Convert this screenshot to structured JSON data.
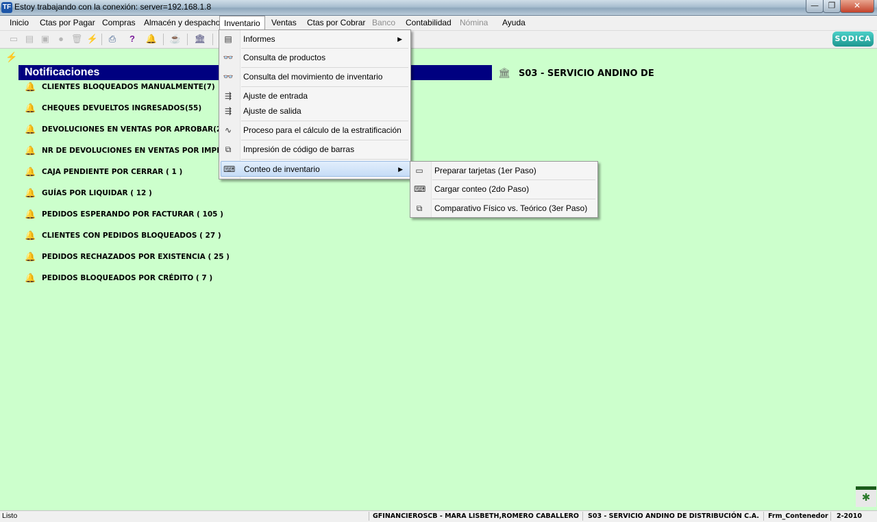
{
  "window": {
    "title": "Estoy trabajando con la conexión: server=192.168.1.8",
    "app_icon": "TF",
    "buttons": {
      "minimize": "—",
      "maximize": "❐",
      "close": "✕"
    }
  },
  "menubar": {
    "items": [
      {
        "label": "Inicio",
        "state": "normal"
      },
      {
        "label": "Ctas por Pagar",
        "state": "normal"
      },
      {
        "label": "Compras",
        "state": "normal"
      },
      {
        "label": "Almacén y despacho",
        "state": "normal"
      },
      {
        "label": "Inventario",
        "state": "active"
      },
      {
        "label": "Ventas",
        "state": "normal"
      },
      {
        "label": "Ctas por Cobrar",
        "state": "normal"
      },
      {
        "label": "Banco",
        "state": "disabled"
      },
      {
        "label": "Contabilidad",
        "state": "normal"
      },
      {
        "label": "Nómina",
        "state": "disabled"
      },
      {
        "label": "Ayuda",
        "state": "normal"
      }
    ]
  },
  "toolbar": {
    "icons": [
      "new-document-icon",
      "open-document-icon",
      "save-icon",
      "record-icon",
      "delete-icon",
      "lightning-icon",
      "print-icon",
      "help-icon",
      "bell-icon",
      "coffee-icon",
      "bank-icon"
    ],
    "logo": "SODICA"
  },
  "notifications": {
    "title": "Notificaciones",
    "company": "S03 - SERVICIO ANDINO DE",
    "items": [
      "CLIENTES BLOQUEADOS MANUALMENTE(7)",
      "CHEQUES DEVUELTOS INGRESADOS(55)",
      "DEVOLUCIONES EN VENTAS POR APROBAR(2)",
      "NR DE DEVOLUCIONES EN VENTAS POR IMPRIMIR(1",
      "CAJA PENDIENTE POR CERRAR  ( 1 )",
      "GUÍAS POR LIQUIDAR  ( 12 )",
      "PEDIDOS ESPERANDO POR FACTURAR  ( 105 )",
      "CLIENTES CON PEDIDOS BLOQUEADOS  ( 27 )",
      "PEDIDOS RECHAZADOS POR EXISTENCIA  ( 25 )",
      "PEDIDOS BLOQUEADOS POR CRÉDITO  ( 7 )"
    ]
  },
  "inventario_menu": {
    "items": [
      {
        "label": "Informes",
        "icon": "report-icon",
        "submenu": true
      },
      {
        "label": "Consulta de productos",
        "icon": "glasses-icon",
        "submenu": false
      },
      {
        "label": "Consulta del movimiento de inventario",
        "icon": "glasses-icon",
        "submenu": false
      },
      {
        "label": "Ajuste de entrada",
        "icon": "adjust-in-icon",
        "submenu": false
      },
      {
        "label": "Ajuste de salida",
        "icon": "adjust-out-icon",
        "submenu": false
      },
      {
        "label": "Proceso para el cálculo de la estratificación",
        "icon": "process-icon",
        "submenu": false
      },
      {
        "label": "Impresión de código de barras",
        "icon": "barcode-icon",
        "submenu": false
      },
      {
        "label": "Conteo de inventario",
        "icon": "count-icon",
        "submenu": true,
        "highlighted": true
      }
    ]
  },
  "conteo_submenu": {
    "items": [
      {
        "label": "Preparar tarjetas (1er Paso)",
        "icon": "card-icon"
      },
      {
        "label": "Cargar conteo (2do Paso)",
        "icon": "load-icon"
      },
      {
        "label": "Comparativo Físico vs. Teórico (3er Paso)",
        "icon": "compare-icon"
      }
    ]
  },
  "statusbar": {
    "status": "Listo",
    "user": "GFINANCIEROSCB - MARA LISBETH,ROMERO CABALLERO",
    "company": "S03 - SERVICIO ANDINO DE DISTRIBUCIÓN C.A.",
    "form": "Frm_Contenedor",
    "period": "2-2010"
  },
  "colors": {
    "background": "#ccffcc",
    "notif_header": "#000080",
    "bell": "#d89a10"
  }
}
